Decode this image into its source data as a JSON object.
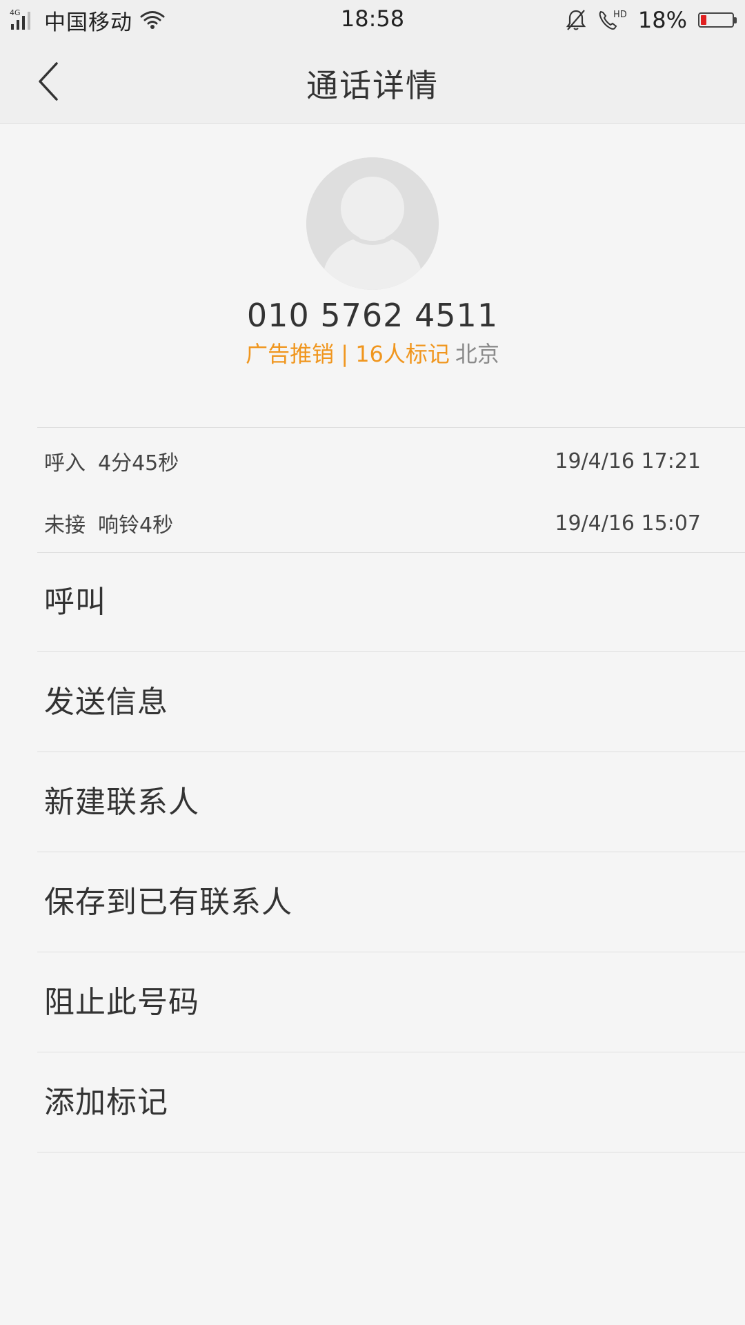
{
  "status_bar": {
    "network": "4G",
    "carrier": "中国移动",
    "time": "18:58",
    "battery_percent": "18%",
    "battery_level": 0.18,
    "icons": [
      "signal-icon",
      "wifi-icon",
      "bell-muted-icon",
      "hd-call-icon",
      "battery-icon"
    ]
  },
  "header": {
    "title": "通话详情",
    "back_icon": "chevron-left-icon"
  },
  "contact": {
    "avatar_icon": "default-avatar-icon",
    "number": "010 5762 4511",
    "tag": "广告推销 | 16人标记",
    "location": "北京"
  },
  "call_log": [
    {
      "type": "呼入",
      "detail": "4分45秒",
      "datetime": "19/4/16 17:21"
    },
    {
      "type": "未接",
      "detail": "响铃4秒",
      "datetime": "19/4/16 15:07"
    }
  ],
  "actions": [
    {
      "label": "呼叫"
    },
    {
      "label": "发送信息"
    },
    {
      "label": "新建联系人"
    },
    {
      "label": "保存到已有联系人"
    },
    {
      "label": "阻止此号码"
    },
    {
      "label": "添加标记"
    }
  ],
  "colors": {
    "background": "#f5f5f5",
    "header_bg": "#efefef",
    "tag_orange": "#f0961e",
    "battery_red": "#e02020"
  }
}
